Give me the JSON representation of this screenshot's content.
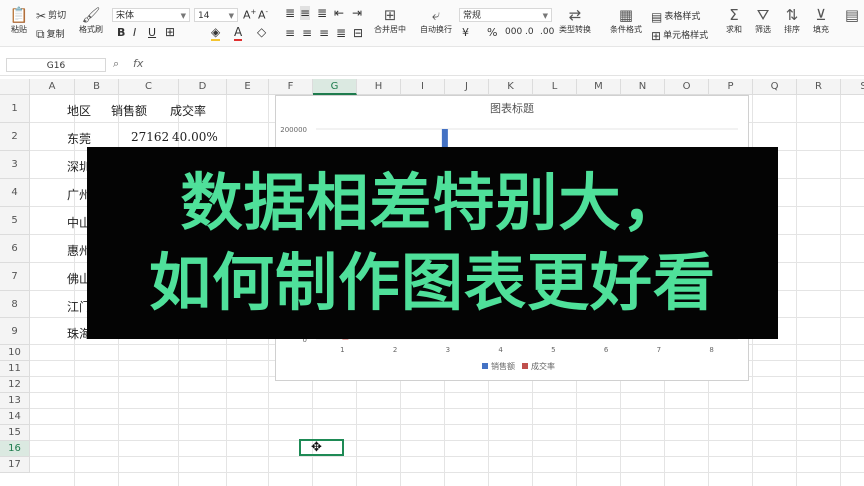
{
  "toolbar": {
    "paste": "粘贴",
    "cut": "剪切",
    "copy": "复制",
    "format_painter": "格式刷",
    "font_name": "宋体",
    "font_size": "14",
    "merge_center": "合并居中",
    "wrap_text": "自动换行",
    "number_format": "常规",
    "type_convert": "类型转换",
    "conditional_format": "条件格式",
    "table_style": "表格样式",
    "cell_style": "单元格样式",
    "sum": "求和",
    "filter": "筛选",
    "sort": "排序",
    "fill": "填充"
  },
  "formula_bar": {
    "name_box": "G16",
    "fx_label": "fx",
    "content": ""
  },
  "columns": [
    "A",
    "B",
    "C",
    "D",
    "E",
    "F",
    "G",
    "H",
    "I",
    "J",
    "K",
    "L",
    "M",
    "N",
    "O",
    "P",
    "Q",
    "R",
    "S"
  ],
  "active_column": "G",
  "rows": [
    "1",
    "2",
    "3",
    "4",
    "5",
    "6",
    "7",
    "8",
    "9",
    "10",
    "11",
    "12",
    "13",
    "14",
    "15",
    "16",
    "17"
  ],
  "active_row": "16",
  "cells": {
    "header": {
      "region": "地区",
      "sales": "销售额",
      "rate": "成交率"
    },
    "row2": {
      "region": "东莞",
      "sales": "27162",
      "rate": "40.00%"
    },
    "partial": [
      "深圳",
      "广州",
      "中山",
      "惠州",
      "佛山",
      "江门",
      "珠海"
    ]
  },
  "chart": {
    "title": "图表标题",
    "y_top_label": "200000",
    "y_zero_label": "0",
    "categories": [
      "1",
      "2",
      "3",
      "4",
      "5",
      "6",
      "7",
      "8"
    ],
    "legend": [
      "销售额",
      "成交率"
    ],
    "colors": {
      "sales": "#4472c4",
      "rate": "#c0504d"
    }
  },
  "chart_data": {
    "type": "bar",
    "title": "图表标题",
    "categories": [
      "1",
      "2",
      "3",
      "4",
      "5",
      "6",
      "7",
      "8"
    ],
    "series": [
      {
        "name": "销售额",
        "values": [
          27162,
          null,
          200000,
          null,
          null,
          null,
          null,
          null
        ]
      },
      {
        "name": "成交率",
        "values": [
          0.4,
          null,
          null,
          null,
          null,
          null,
          null,
          null
        ]
      }
    ],
    "ylim": [
      0,
      200000
    ],
    "legend": "bottom"
  },
  "overlay": {
    "line1": "数据相差特别大，",
    "line2": "如何制作图表更好看"
  }
}
